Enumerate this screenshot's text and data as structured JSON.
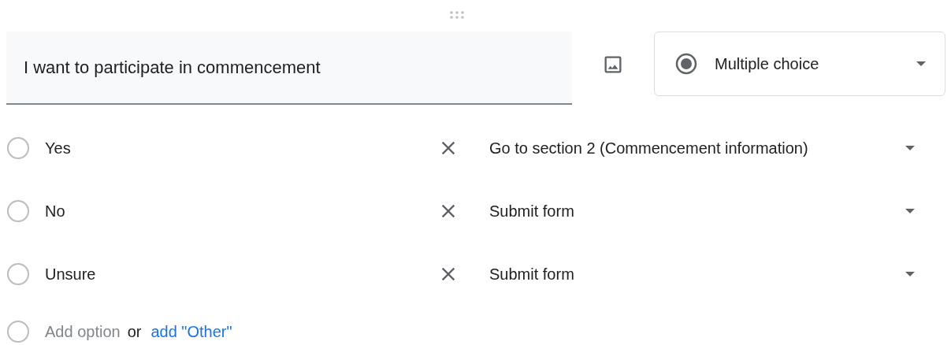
{
  "question": {
    "title": "I want to participate in commencement"
  },
  "question_type": {
    "label": "Multiple choice"
  },
  "options": [
    {
      "label": "Yes",
      "destination": "Go to section 2 (Commencement information)"
    },
    {
      "label": "No",
      "destination": "Submit form"
    },
    {
      "label": "Unsure",
      "destination": "Submit form"
    }
  ],
  "add_option": {
    "label": "Add option",
    "separator": "or",
    "other_link": "add \"Other\""
  }
}
